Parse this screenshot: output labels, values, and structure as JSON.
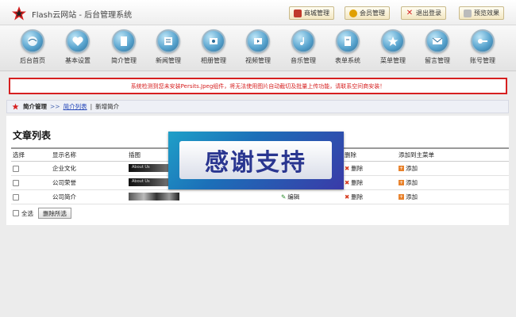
{
  "app": {
    "title": "Flash云网站 - 后台管理系统"
  },
  "top_buttons": [
    {
      "label": "商城管理",
      "icon": "shop-icon",
      "color": "#c0392b"
    },
    {
      "label": "会员管理",
      "icon": "member-icon",
      "color": "#e0a000"
    },
    {
      "label": "退出登录",
      "icon": "close-icon",
      "color": "#d62020"
    },
    {
      "label": "预览效果",
      "icon": "preview-icon",
      "color": "#888888"
    }
  ],
  "nav": [
    {
      "label": "后台首页",
      "icon": "home-icon"
    },
    {
      "label": "基本设置",
      "icon": "heart-icon"
    },
    {
      "label": "简介管理",
      "icon": "doc-icon"
    },
    {
      "label": "新闻管理",
      "icon": "news-icon"
    },
    {
      "label": "相册管理",
      "icon": "album-icon"
    },
    {
      "label": "视频管理",
      "icon": "video-icon"
    },
    {
      "label": "音乐管理",
      "icon": "music-icon"
    },
    {
      "label": "表单系统",
      "icon": "form-icon"
    },
    {
      "label": "菜单管理",
      "icon": "star-icon"
    },
    {
      "label": "留言管理",
      "icon": "mail-icon"
    },
    {
      "label": "账号管理",
      "icon": "key-icon"
    }
  ],
  "warning": "系统检测到您未安装Persits.Jpeg组件，将无法使用图片自动截切及批量上传功能，请联系空间商安装！",
  "breadcrumb": {
    "section": "简介管理",
    "link": "简介列表",
    "current": "新增简介"
  },
  "list": {
    "title": "文章列表",
    "columns": [
      "选择",
      "显示名称",
      "插图",
      "",
      "删除",
      "添加到主菜单"
    ],
    "rows": [
      {
        "name": "企业文化",
        "thumb_text": "About Us",
        "edit": "",
        "delete": "删除",
        "add": "添加"
      },
      {
        "name": "公司荣誉",
        "thumb_text": "About Us",
        "edit": "",
        "delete": "删除",
        "add": "添加"
      },
      {
        "name": "公司简介",
        "thumb_text": "",
        "edit": "编辑",
        "delete": "删除",
        "add": "添加"
      }
    ],
    "select_all": "全选",
    "delete_selected": "删除所选"
  },
  "overlay": {
    "text": "感谢支持"
  }
}
